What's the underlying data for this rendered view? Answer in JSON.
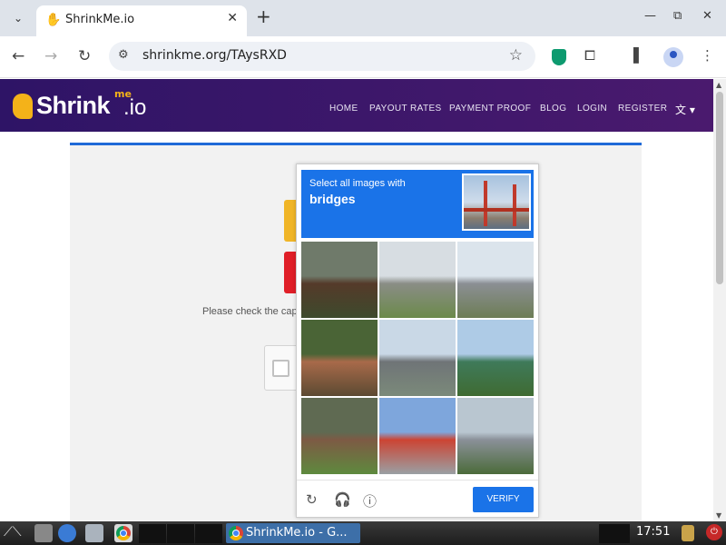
{
  "browser": {
    "tab_title": "ShrinkMe.io",
    "url": "shrinkme.org/TAysRXD",
    "icons": {
      "tab_menu": "chevron-down-icon",
      "favicon": "hand-icon",
      "close": "close-icon",
      "new_tab": "plus-icon",
      "back": "back-arrow-icon",
      "forward": "forward-arrow-icon",
      "reload": "reload-icon",
      "site_info": "tune-icon",
      "bookmark": "star-icon",
      "extension": "puzzle-icon",
      "sidepanel": "side-panel-icon",
      "profile": "profile-icon",
      "menu": "kebab-menu-icon"
    },
    "glyphs": {
      "tab_menu": "⌄",
      "favicon": "✋",
      "close": "✕",
      "new_tab": "+",
      "minimize": "—",
      "maximize": "⧉",
      "win_close": "✕",
      "back": "←",
      "forward": "→",
      "reload": "↻",
      "site_info": "⚙",
      "bookmark": "☆",
      "extension": "⧠",
      "sidepanel": "▌",
      "menu": "⋮"
    }
  },
  "site": {
    "logo_text": "Shrink",
    "logo_me": "me",
    "logo_io": ".io",
    "nav": [
      "HOME",
      "PAYOUT RATES",
      "PAYMENT PROOF",
      "BLOG",
      "LOGIN",
      "REGISTER"
    ],
    "lang_glyph": "文 ▾",
    "brand_color": "#2e1466",
    "accent_color": "#f4b219"
  },
  "page": {
    "check_text": "Please check the captcha",
    "yellow_btn_color": "#f0b527",
    "red_btn_color": "#e01f28"
  },
  "captcha": {
    "prompt_line1": "Select all images with",
    "prompt_line2": "bridges",
    "verify_label": "VERIFY",
    "footer_icons": {
      "reload": "reload-icon",
      "audio": "headphones-icon",
      "info": "info-icon"
    },
    "footer_glyphs": {
      "reload": "↻",
      "audio": "🎧",
      "info": "ⓘ"
    },
    "tiles": [
      {
        "name": "tile-1",
        "sky": "#6f7a6a",
        "ground": "#3d4a2c",
        "accent": "#553a2a"
      },
      {
        "name": "tile-2",
        "sky": "#d7dde2",
        "ground": "#6b8a4a",
        "accent": "#8a8d86"
      },
      {
        "name": "tile-3",
        "sky": "#dbe4ec",
        "ground": "#6d7d55",
        "accent": "#8b8f94"
      },
      {
        "name": "tile-4",
        "sky": "#4a6436",
        "ground": "#5c4a32",
        "accent": "#a86a4a"
      },
      {
        "name": "tile-5",
        "sky": "#c9d8e6",
        "ground": "#7b8a7a",
        "accent": "#6f7477"
      },
      {
        "name": "tile-6",
        "sky": "#aecbe6",
        "ground": "#3f6b32",
        "accent": "#3f7a5a"
      },
      {
        "name": "tile-7",
        "sky": "#5f6a52",
        "ground": "#5e8a3e",
        "accent": "#7d5a44"
      },
      {
        "name": "tile-8",
        "sky": "#7ea6dc",
        "ground": "#9aa0a4",
        "accent": "#cc4433"
      },
      {
        "name": "tile-9",
        "sky": "#b9c6d0",
        "ground": "#4b6b3a",
        "accent": "#8a9098"
      }
    ]
  },
  "taskbar": {
    "task_label": "ShrinkMe.io - G...",
    "clock": "17:51",
    "power_glyph": "⏻"
  }
}
